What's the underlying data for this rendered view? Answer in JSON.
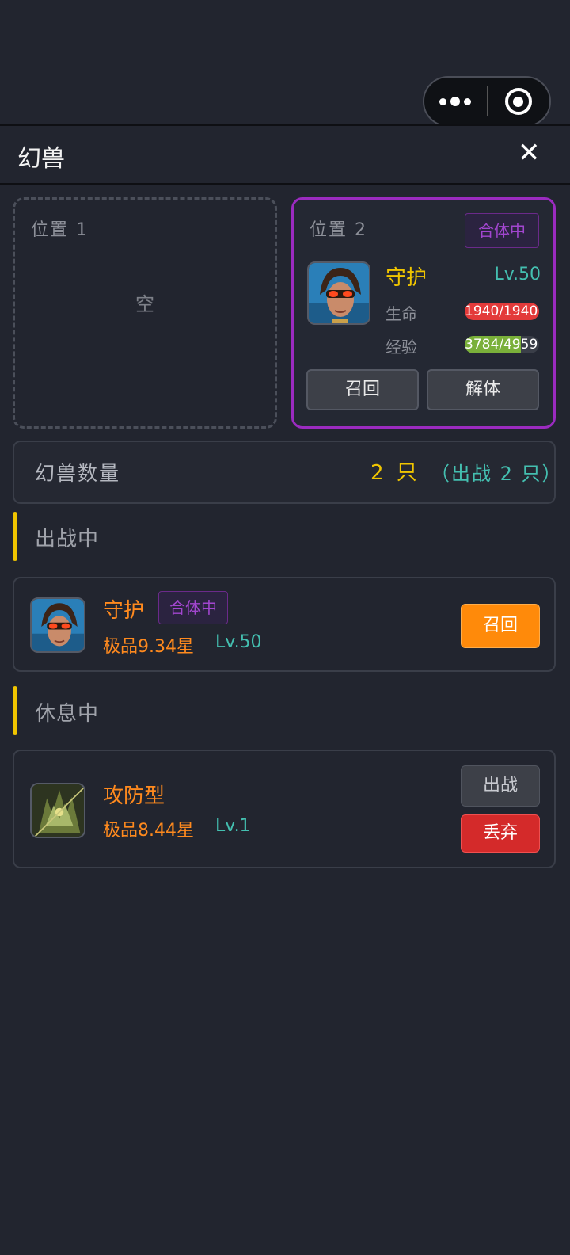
{
  "colors": {
    "background": "#22252f",
    "accent_gold": "#f0c500",
    "teal": "#44bfb0",
    "orange": "#ff8a1e",
    "purple": "#9b2bc0",
    "hp_bar": "#e33a3a",
    "exp_bar": "#7ab03a",
    "danger": "#d42a2a"
  },
  "capsule": {
    "menu_icon": "more-dots-icon",
    "close_icon": "target-icon"
  },
  "header": {
    "title": "幻兽",
    "close_label": "✕"
  },
  "slots": [
    {
      "position_label": "位置 1",
      "empty_label": "空"
    },
    {
      "position_label": "位置 2",
      "fuse_badge": "合体中",
      "pet_name": "守护",
      "level": "Lv.50",
      "hp_label": "生命",
      "hp_text": "1940/1940",
      "hp_fraction": 1.0,
      "exp_label": "经验",
      "exp_text": "3784/4959",
      "exp_fraction": 0.76,
      "recall_button": "召回",
      "unfuse_button": "解体"
    }
  ],
  "summary": {
    "label": "幻兽数量",
    "count": "2 只",
    "battle": "（出战 2 只）"
  },
  "sections": {
    "battle_title": "出战中",
    "rest_title": "休息中"
  },
  "battle_pets": [
    {
      "name": "守护",
      "fuse_badge": "合体中",
      "grade": "极品9.34星",
      "level": "Lv.50",
      "recall_button": "召回"
    }
  ],
  "rest_pets": [
    {
      "name": "攻防型",
      "grade": "极品8.44星",
      "level": "Lv.1",
      "fight_button": "出战",
      "drop_button": "丢弃"
    }
  ]
}
